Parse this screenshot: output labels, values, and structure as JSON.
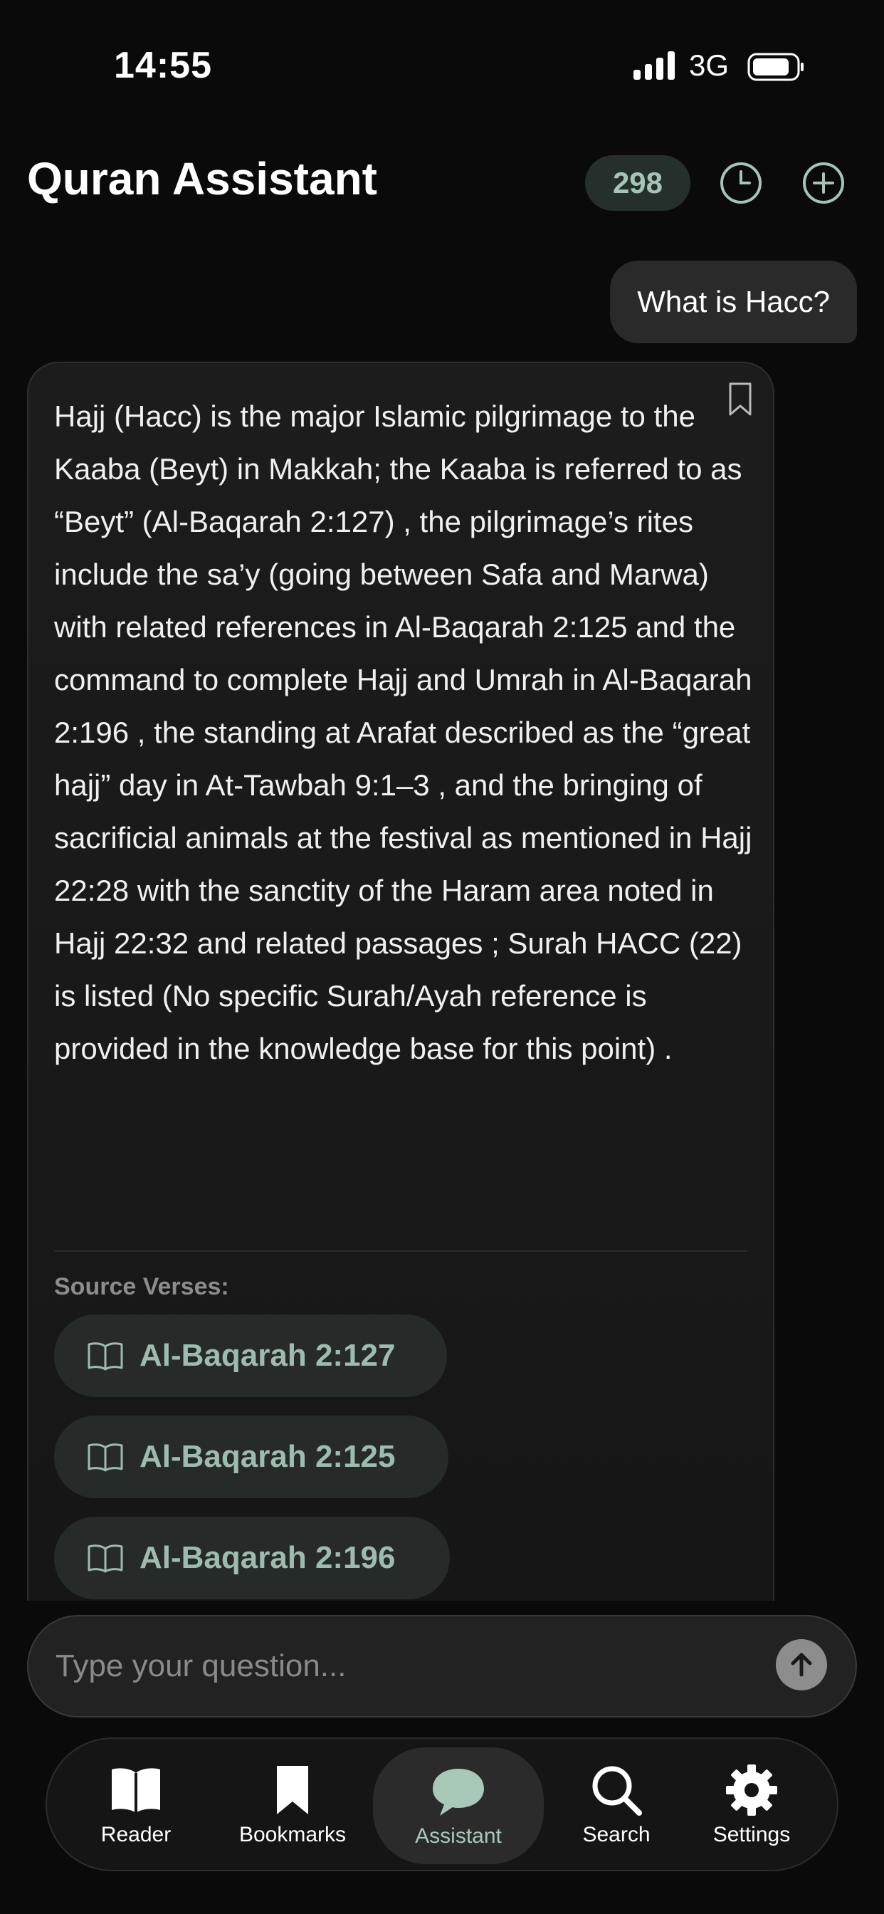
{
  "status_bar": {
    "time": "14:55",
    "network": "3G"
  },
  "header": {
    "title": "Quran Assistant",
    "count": "298"
  },
  "chat": {
    "user_message": "What is Hacc?",
    "answer": "Hajj (Hacc) is the major Islamic pilgrimage to the Kaaba (Beyt) in Makkah; the Kaaba is referred to as “Beyt” (Al-Baqarah 2:127) , the pilgrimage’s rites include the sa’y (going between Safa and Marwa) with related references in Al-Baqarah 2:125 and the command to complete Hajj and Umrah in Al-Baqarah 2:196 , the standing at Arafat described as the “great hajj” day in At-Tawbah 9:1–3 , and the bringing of sacrificial animals at the festival as mentioned in Hajj 22:28 with the sanctity of the Haram area noted in Hajj 22:32 and related passages ; Surah HACC (22) is listed (No specific Surah/Ayah reference is provided in the knowledge base for this point) .",
    "sources_label": "Source Verses:",
    "sources": [
      "Al-Baqarah 2:127",
      "Al-Baqarah 2:125",
      "Al-Baqarah 2:196"
    ]
  },
  "input": {
    "placeholder": "Type your question..."
  },
  "tabs": [
    {
      "label": "Reader",
      "icon": "book-open-icon"
    },
    {
      "label": "Bookmarks",
      "icon": "bookmark-icon"
    },
    {
      "label": "Assistant",
      "icon": "chat-bubble-icon",
      "active": true
    },
    {
      "label": "Search",
      "icon": "search-icon"
    },
    {
      "label": "Settings",
      "icon": "gear-icon"
    }
  ],
  "colors": {
    "background": "#0a0a0a",
    "accent": "#a6c4b6",
    "card": "#1c1c1c"
  }
}
